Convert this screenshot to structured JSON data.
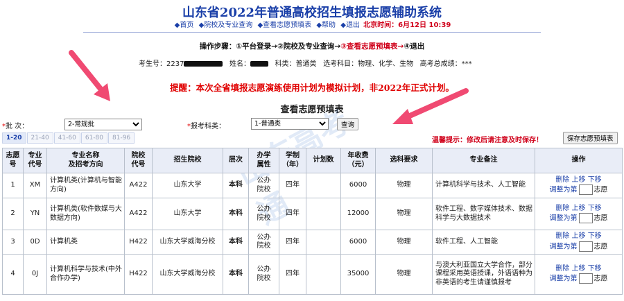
{
  "header": {
    "title": "山东省2022年普通高校招生填报志愿辅助系统",
    "nav": [
      {
        "icon": "diamond-icon",
        "label": "首页"
      },
      {
        "icon": "diamond-icon",
        "label": "院校及专业查询"
      },
      {
        "icon": "diamond-icon",
        "label": "查看志愿预填表"
      },
      {
        "icon": "diamond-icon",
        "label": "帮助"
      },
      {
        "icon": "diamond-icon",
        "label": "退出"
      }
    ],
    "time": "北京时间：6月12日 10:39"
  },
  "steps": {
    "label": "操作步骤：",
    "s1": "①平台登录→",
    "s2": "②院校及专业查询→",
    "s3": "③查看志愿预填表→",
    "s4": "④退出"
  },
  "student": {
    "id_label": "考生号：2237",
    "name_label": "姓名：",
    "subject": "科类：普通类",
    "elective": "选考科目：物理、化学、生物",
    "score": "高考总成绩：***"
  },
  "notice": "提醒：本次全省填报志愿演练使用计划为模拟计划，非2022年正式计划。",
  "subtitle": "查看志愿预填表",
  "filters": {
    "batch_label": "批  次：",
    "batch_value": "2-常规批",
    "type_label": "报考科类：",
    "type_value": "1-普通类",
    "query_button": "查询",
    "warm_tip": "温馨提示：修改后请注意及时保存！",
    "save_button": "保存志愿预填表"
  },
  "pager": [
    "1-20",
    "21-40",
    "41-60",
    "61-80",
    "81-96"
  ],
  "table": {
    "headers": [
      "志愿\n号",
      "专业\n代号",
      "专业名称\n及招考方向",
      "院校\n代号",
      "招生院校",
      "层次",
      "办学\n属性",
      "学制\n（年）",
      "计划数",
      "年收费\n（元）",
      "选科要求",
      "专业备注",
      "操作"
    ],
    "rows": [
      {
        "no": "1",
        "code": "XM",
        "major": "计算机类(计算机与智能方向)",
        "school_code": "A422",
        "school": "山东大学",
        "level": "本科",
        "attr": "公办\n院校",
        "years": "四年",
        "plan": "",
        "fee": "6000",
        "req": "物理",
        "note": "计算机科学与技术、人工智能"
      },
      {
        "no": "2",
        "code": "YN",
        "major": "计算机类(软件数媒与大数据方向)",
        "school_code": "A422",
        "school": "山东大学",
        "level": "本科",
        "attr": "公办\n院校",
        "years": "四年",
        "plan": "",
        "fee": "12000",
        "req": "物理",
        "note": "软件工程、数字媒体技术、数据科学与大数据技术"
      },
      {
        "no": "3",
        "code": "0D",
        "major": "计算机类",
        "school_code": "H422",
        "school": "山东大学威海分校",
        "level": "本科",
        "attr": "公办\n院校",
        "years": "四年",
        "plan": "",
        "fee": "6000",
        "req": "物理",
        "note": "软件工程、人工智能"
      },
      {
        "no": "4",
        "code": "0J",
        "major": "计算机科学与技术(中外合作办学)",
        "school_code": "H422",
        "school": "山东大学威海分校",
        "level": "本科",
        "attr": "公办\n院校",
        "years": "四年",
        "plan": "",
        "fee": "35000",
        "req": "物理",
        "note": "与澳大利亚国立大学合作，部分课程采用英语授课，外语语种为非英语的考生请谨慎报考"
      }
    ],
    "ops": {
      "delete": "删除",
      "up": "上移",
      "down": "下移",
      "adjust": "调整为第",
      "unit": "志愿"
    }
  },
  "watermark": "山东高考通",
  "colors": {
    "brand_blue": "#1a3fa8",
    "alert_red": "#e00000",
    "header_bg": "#e9edf7"
  }
}
